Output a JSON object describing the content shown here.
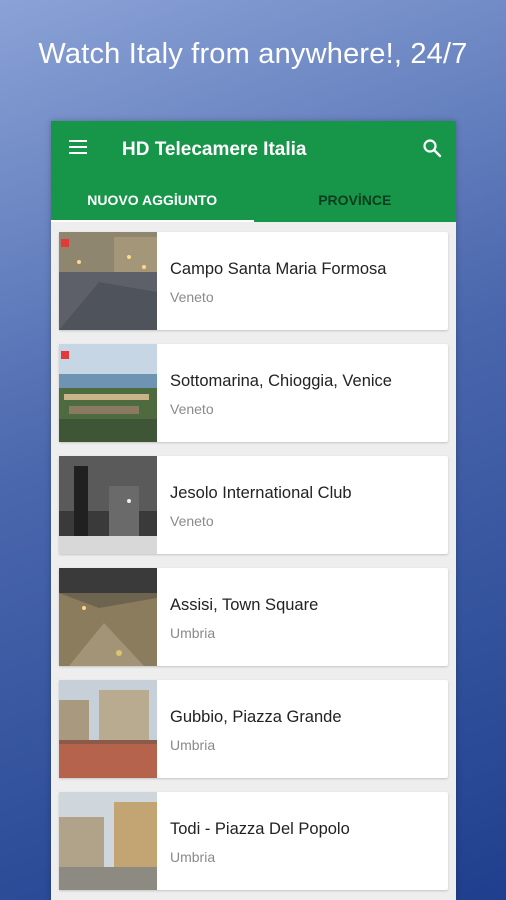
{
  "promo": {
    "headline": "Watch Italy from anywhere!, 24/7"
  },
  "appbar": {
    "title": "HD Telecamere Italia",
    "color": "#17964a",
    "icons": {
      "menu": "menu-icon",
      "search": "search-icon"
    }
  },
  "tabs": [
    {
      "label": "NUOVO AGGİUNTO",
      "active": true
    },
    {
      "label": "PROVİNCE",
      "active": false
    }
  ],
  "cameras": [
    {
      "title": "Campo Santa Maria Formosa",
      "region": "Veneto",
      "live": true
    },
    {
      "title": "Sottomarina, Chioggia, Venice",
      "region": "Veneto",
      "live": true
    },
    {
      "title": "Jesolo International Club",
      "region": "Veneto",
      "live": false
    },
    {
      "title": "Assisi, Town Square",
      "region": "Umbria",
      "live": false
    },
    {
      "title": "Gubbio, Piazza Grande",
      "region": "Umbria",
      "live": false
    },
    {
      "title": "Todi - Piazza Del Popolo",
      "region": "Umbria",
      "live": false
    }
  ]
}
